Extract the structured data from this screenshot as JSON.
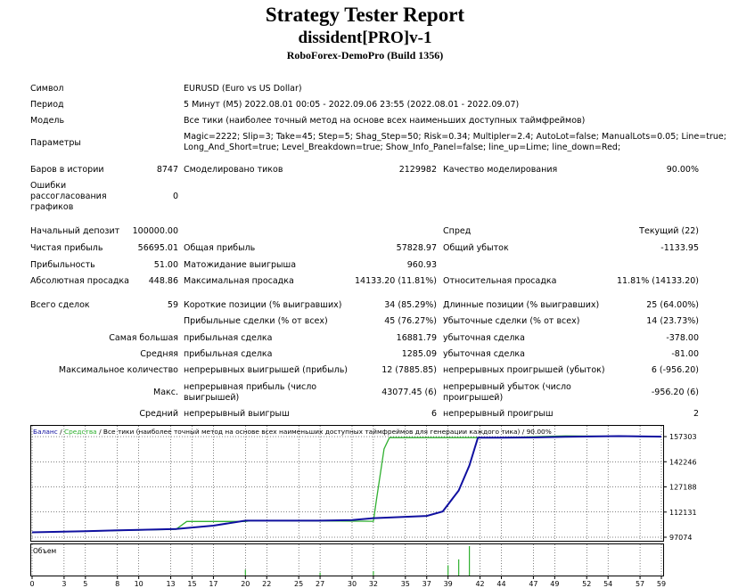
{
  "report": {
    "title": "Strategy Tester Report",
    "expert": "dissident[PRO]v-1",
    "server": "RoboForex-DemoPro (Build 1356)"
  },
  "info": {
    "symbol_label": "Символ",
    "symbol_value": "EURUSD (Euro vs US Dollar)",
    "period_label": "Период",
    "period_value": "5 Минут (M5) 2022.08.01 00:05 - 2022.09.06 23:55 (2022.08.01 - 2022.09.07)",
    "model_label": "Модель",
    "model_value": "Все тики (наиболее точный метод на основе всех наименьших доступных таймфреймов)",
    "params_label": "Параметры",
    "params_line1": "Magic=2222; Slip=3; Take=45; Step=5; Shag_Step=50; Risk=0.34; Multipler=2.4; AutoLot=false; ManualLots=0.05; Line=true;",
    "params_line2": "Long_And_Short=true; Level_Breakdown=true; Show_Info_Panel=false; line_up=Lime; line_down=Red;"
  },
  "stats": {
    "bars_label": "Баров в истории",
    "bars_value": "8747",
    "ticks_label": "Смоделировано тиков",
    "ticks_value": "2129982",
    "quality_label": "Качество моделирования",
    "quality_value": "90.00%",
    "mismatch_l1": "Ошибки",
    "mismatch_l2": "рассогласования",
    "mismatch_l3": "графиков",
    "mismatch_value": "0",
    "deposit_label": "Начальный депозит",
    "deposit_value": "100000.00",
    "spread_label": "Спред",
    "spread_value": "Текущий (22)",
    "net_label": "Чистая прибыль",
    "net_value": "56695.01",
    "gross_profit_label": "Общая прибыль",
    "gross_profit_value": "57828.97",
    "gross_loss_label": "Общий убыток",
    "gross_loss_value": "-1133.95",
    "pf_label": "Прибыльность",
    "pf_value": "51.00",
    "expected_label": "Матожидание выигрыша",
    "expected_value": "960.93",
    "abs_dd_label": "Абсолютная просадка",
    "abs_dd_value": "448.86",
    "max_dd_label": "Максимальная просадка",
    "max_dd_value": "14133.20 (11.81%)",
    "rel_dd_label": "Относительная просадка",
    "rel_dd_value": "11.81% (14133.20)",
    "total_label": "Всего сделок",
    "total_value": "59",
    "short_label": "Короткие позиции (% выигравших)",
    "short_value": "34 (85.29%)",
    "long_label": "Длинные позиции (% выигравших)",
    "long_value": "25 (64.00%)",
    "profit_trades_label": "Прибыльные сделки (% от всех)",
    "profit_trades_value": "45 (76.27%)",
    "loss_trades_label": "Убыточные сделки (% от всех)",
    "loss_trades_value": "14 (23.73%)",
    "largest_label": "Самая большая",
    "largest_profit_label": "прибыльная сделка",
    "largest_profit_value": "16881.79",
    "largest_loss_label": "убыточная сделка",
    "largest_loss_value": "-378.00",
    "avg_label": "Средняя",
    "avg_profit_label": "прибыльная сделка",
    "avg_profit_value": "1285.09",
    "avg_loss_label": "убыточная сделка",
    "avg_loss_value": "-81.00",
    "max_count_label": "Максимальное количество",
    "consec_wins_label": "непрерывных выигрышей (прибыль)",
    "consec_wins_value": "12 (7885.85)",
    "consec_losses_label": "непрерывных проигрышей (убыток)",
    "consec_losses_value": "6 (-956.20)",
    "max_label": "Макс.",
    "consec_profit_l1": "непрерывная прибыль (число",
    "consec_profit_l2": "выигрышей)",
    "consec_profit_value": "43077.45 (6)",
    "consec_loss_l1": "непрерывный убыток (число",
    "consec_loss_l2": "проигрышей)",
    "consec_loss_value": "-956.20 (6)",
    "avg2_label": "Средний",
    "avg_wins_label": "непрерывный выигрыш",
    "avg_wins_value": "6",
    "avg_losses_label": "непрерывный проигрыш",
    "avg_losses_value": "2"
  },
  "chart_data": {
    "type": "line",
    "legend": {
      "balance": "Баланс",
      "sep1": " / ",
      "equity": "Средства",
      "sep2": " / ",
      "rest": "Все тики (наиболее точный метод на основе всех наименьших доступных таймфреймов для генерации каждого тика) / 90.00%"
    },
    "volume_label": "Объем",
    "y_ticks": [
      157303,
      142246,
      127188,
      112131,
      97074
    ],
    "ylim": [
      97074,
      160000
    ],
    "x_ticks": [
      0,
      3,
      5,
      8,
      10,
      13,
      15,
      17,
      20,
      22,
      25,
      27,
      30,
      32,
      35,
      37,
      39,
      42,
      44,
      47,
      49,
      52,
      54,
      57,
      59
    ],
    "xlim": [
      0,
      59
    ],
    "colors": {
      "balance": "#1010a0",
      "equity": "#30b030",
      "volume": "#30b030",
      "axis": "#000000"
    },
    "balance": [
      [
        0,
        100000
      ],
      [
        5,
        100700
      ],
      [
        10,
        101500
      ],
      [
        13.5,
        102000
      ],
      [
        17,
        104000
      ],
      [
        20,
        107000
      ],
      [
        27,
        107000
      ],
      [
        30,
        107300
      ],
      [
        32,
        108500
      ],
      [
        37,
        109800
      ],
      [
        38.5,
        112500
      ],
      [
        40,
        125000
      ],
      [
        41,
        140000
      ],
      [
        41.8,
        156700
      ],
      [
        44,
        156700
      ],
      [
        47,
        156800
      ],
      [
        50,
        157200
      ],
      [
        55,
        157600
      ],
      [
        59,
        157303
      ]
    ],
    "equity": [
      [
        0,
        100000
      ],
      [
        13.5,
        101800
      ],
      [
        14.5,
        106500
      ],
      [
        20,
        106500
      ],
      [
        20.5,
        107000
      ],
      [
        32,
        106600
      ],
      [
        32.3,
        120000
      ],
      [
        33,
        150000
      ],
      [
        33.5,
        156700
      ],
      [
        44,
        156700
      ],
      [
        50,
        157700
      ],
      [
        59,
        157303
      ]
    ],
    "volume": [
      [
        20,
        0.2
      ],
      [
        27,
        0.1
      ],
      [
        32,
        0.15
      ],
      [
        39,
        0.35
      ],
      [
        40,
        0.55
      ],
      [
        41,
        1.0
      ]
    ]
  }
}
